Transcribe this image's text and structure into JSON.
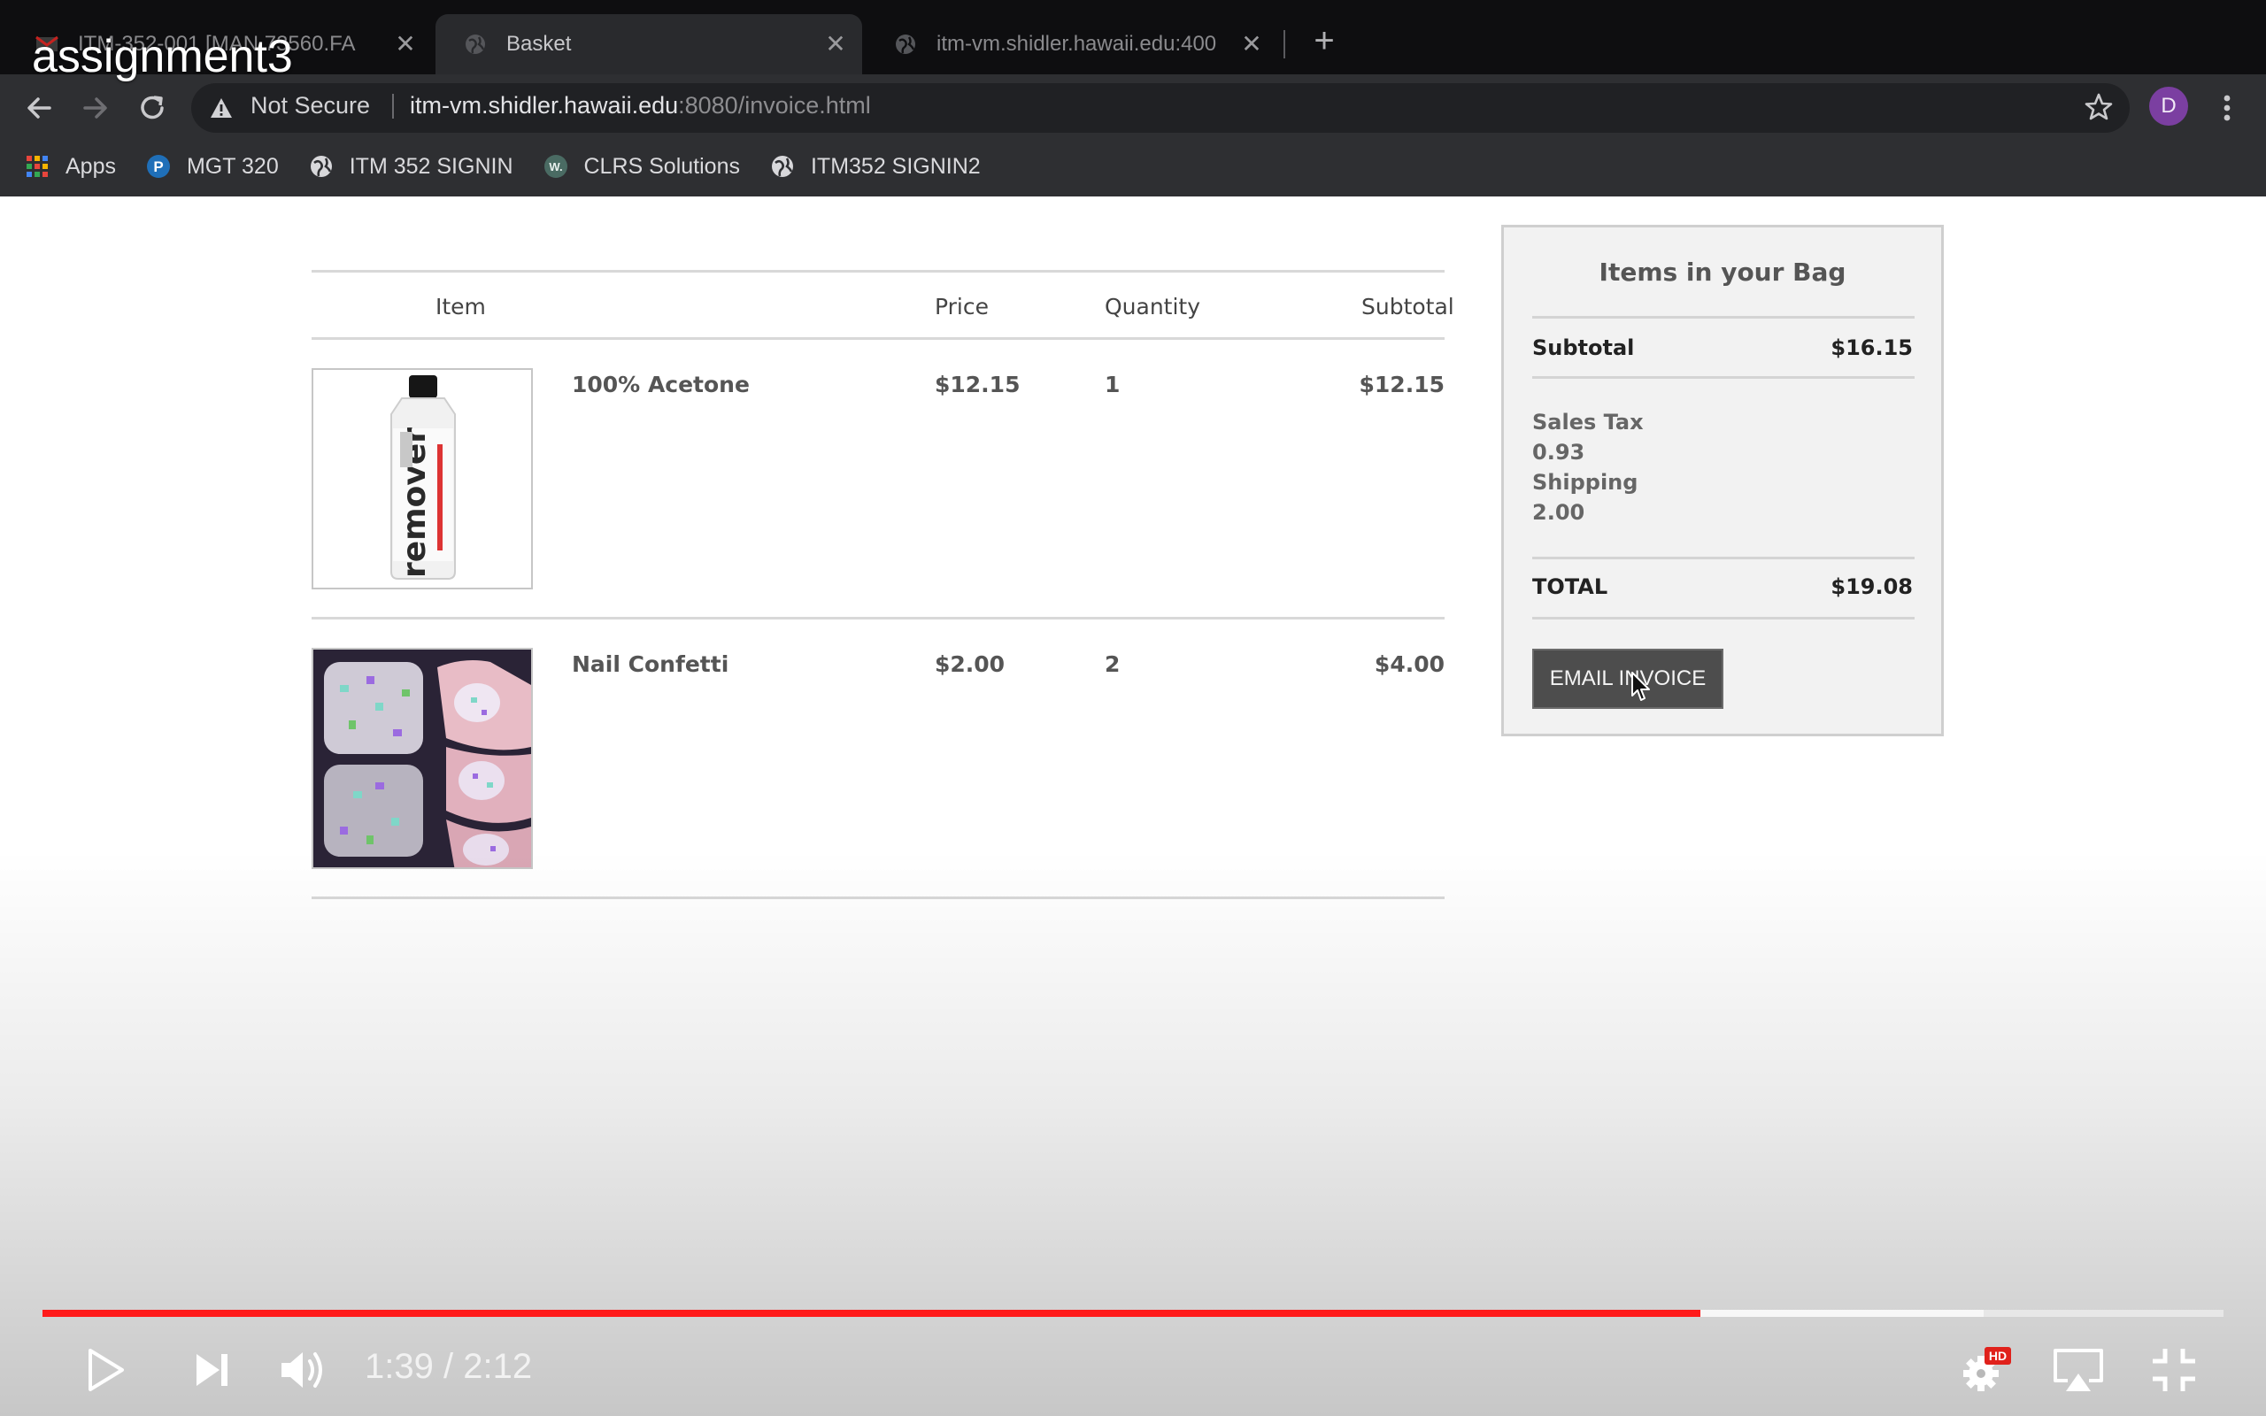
{
  "video": {
    "title": "assignment3",
    "time_current": "1:39",
    "time_separator": "/",
    "time_total": "2:12",
    "played_fraction": 0.76,
    "buffered_fraction": 0.89,
    "hd_badge": "HD"
  },
  "browser": {
    "tabs": [
      {
        "title": "ITM-352-001 [MAN.73560.FA",
        "favicon": "gmail-icon",
        "active": false
      },
      {
        "title": "Basket",
        "favicon": "globe-icon",
        "active": true
      },
      {
        "title": "itm-vm.shidler.hawaii.edu:400",
        "favicon": "globe-icon",
        "active": false
      }
    ],
    "new_tab": "+",
    "security": "Not Secure",
    "url_host": "itm-vm.shidler.hawaii.edu",
    "url_rest": ":8080/invoice.html",
    "profile_initial": "D",
    "bookmarks": [
      {
        "label": "Apps",
        "icon": "apps-grid-icon"
      },
      {
        "label": "MGT 320",
        "icon": "pearson-icon"
      },
      {
        "label": "ITM 352 SIGNIN",
        "icon": "globe-icon"
      },
      {
        "label": "CLRS Solutions",
        "icon": "w-site-icon"
      },
      {
        "label": "ITM352 SIGNIN2",
        "icon": "globe-icon"
      }
    ]
  },
  "invoice": {
    "headers": {
      "item": "Item",
      "price": "Price",
      "quantity": "Quantity",
      "subtotal": "Subtotal"
    },
    "rows": [
      {
        "name": "100% Acetone",
        "price": "$12.15",
        "quantity": "1",
        "subtotal": "$12.15",
        "image": "acetone-bottle"
      },
      {
        "name": "Nail Confetti",
        "price": "$2.00",
        "quantity": "2",
        "subtotal": "$4.00",
        "image": "nail-confetti"
      }
    ]
  },
  "bag": {
    "title": "Items in your Bag",
    "subtotal_label": "Subtotal",
    "subtotal_value": "$16.15",
    "tax_label": "Sales Tax",
    "tax_value": "0.93",
    "shipping_label": "Shipping",
    "shipping_value": "2.00",
    "total_label": "TOTAL",
    "total_value": "$19.08",
    "email_button": "EMAIL INVOICE"
  },
  "product_label_text": "remover",
  "colors": {
    "progress": "#ff1a1a",
    "avatar": "#7b3fa1",
    "button": "#4d4d4d"
  }
}
